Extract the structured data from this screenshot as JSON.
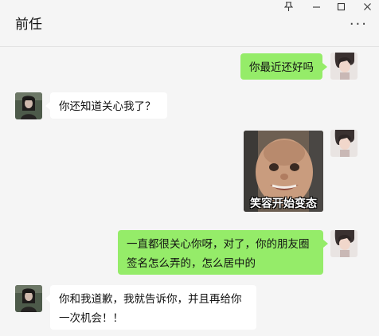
{
  "window": {
    "title": "前任",
    "controls": {
      "pin_glyph": "ᐳ",
      "minimize_glyph": "—",
      "maximize_glyph": "□",
      "close_glyph": "✕"
    },
    "more_glyph": "···"
  },
  "colors": {
    "my_bubble": "#95ec69",
    "their_bubble": "#ffffff",
    "background": "#f5f5f5"
  },
  "messages": [
    {
      "sender": "me",
      "text": "你最近还好吗"
    },
    {
      "sender": "other",
      "text": "你还知道关心我了？"
    },
    {
      "sender": "me",
      "type": "sticker",
      "caption": "笑容开始变态"
    },
    {
      "sender": "me",
      "line1": "一直都很关心你呀，对了，你的朋友圈",
      "line2": "签名怎么弄的，怎么居中的"
    },
    {
      "sender": "other",
      "line1": "你和我道歉，我就告诉你，并且再给你",
      "line2": "一次机会！！"
    }
  ]
}
